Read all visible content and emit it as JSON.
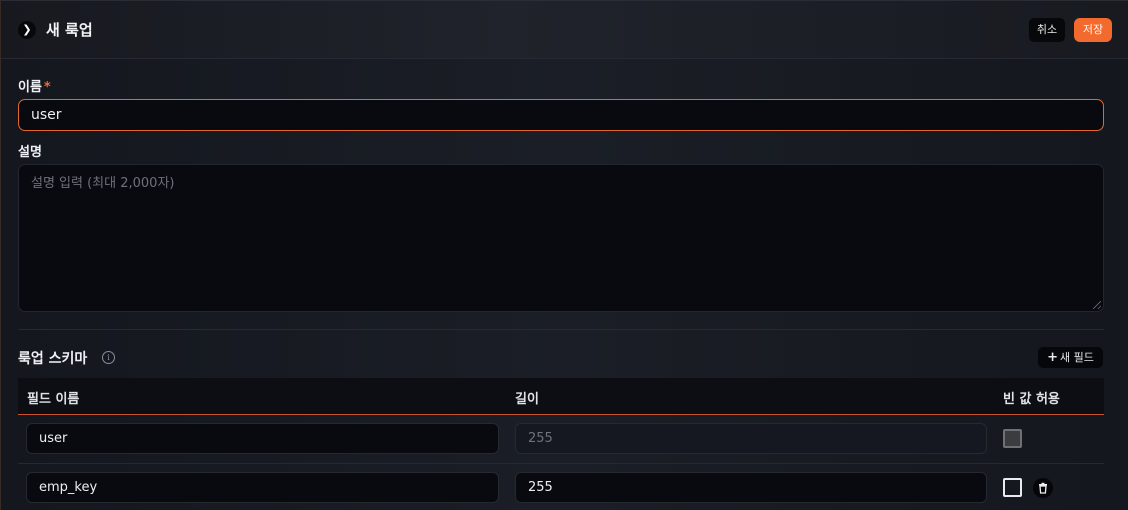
{
  "header": {
    "title": "새 룩업",
    "cancel_label": "취소",
    "save_label": "저장",
    "expand_icon": "chevron-right-icon"
  },
  "form": {
    "name_label": "이름",
    "required_mark": "*",
    "name_value": "user",
    "description_label": "설명",
    "description_placeholder": "설명 입력 (최대 2,000자)"
  },
  "schema": {
    "title": "룩업 스키마",
    "info_icon": "info-icon",
    "new_field_label": "새 필드",
    "columns": [
      "필드 이름",
      "길이",
      "빈 값 허용"
    ],
    "rows": [
      {
        "field_name": "user",
        "length": "255",
        "length_disabled": true,
        "nullable_disabled": true
      },
      {
        "field_name": "emp_key",
        "length": "255",
        "length_disabled": false,
        "nullable_disabled": false
      }
    ]
  },
  "colors": {
    "accent": "#f36a2e",
    "background": "#14171e",
    "input_bg": "#080a0f"
  }
}
